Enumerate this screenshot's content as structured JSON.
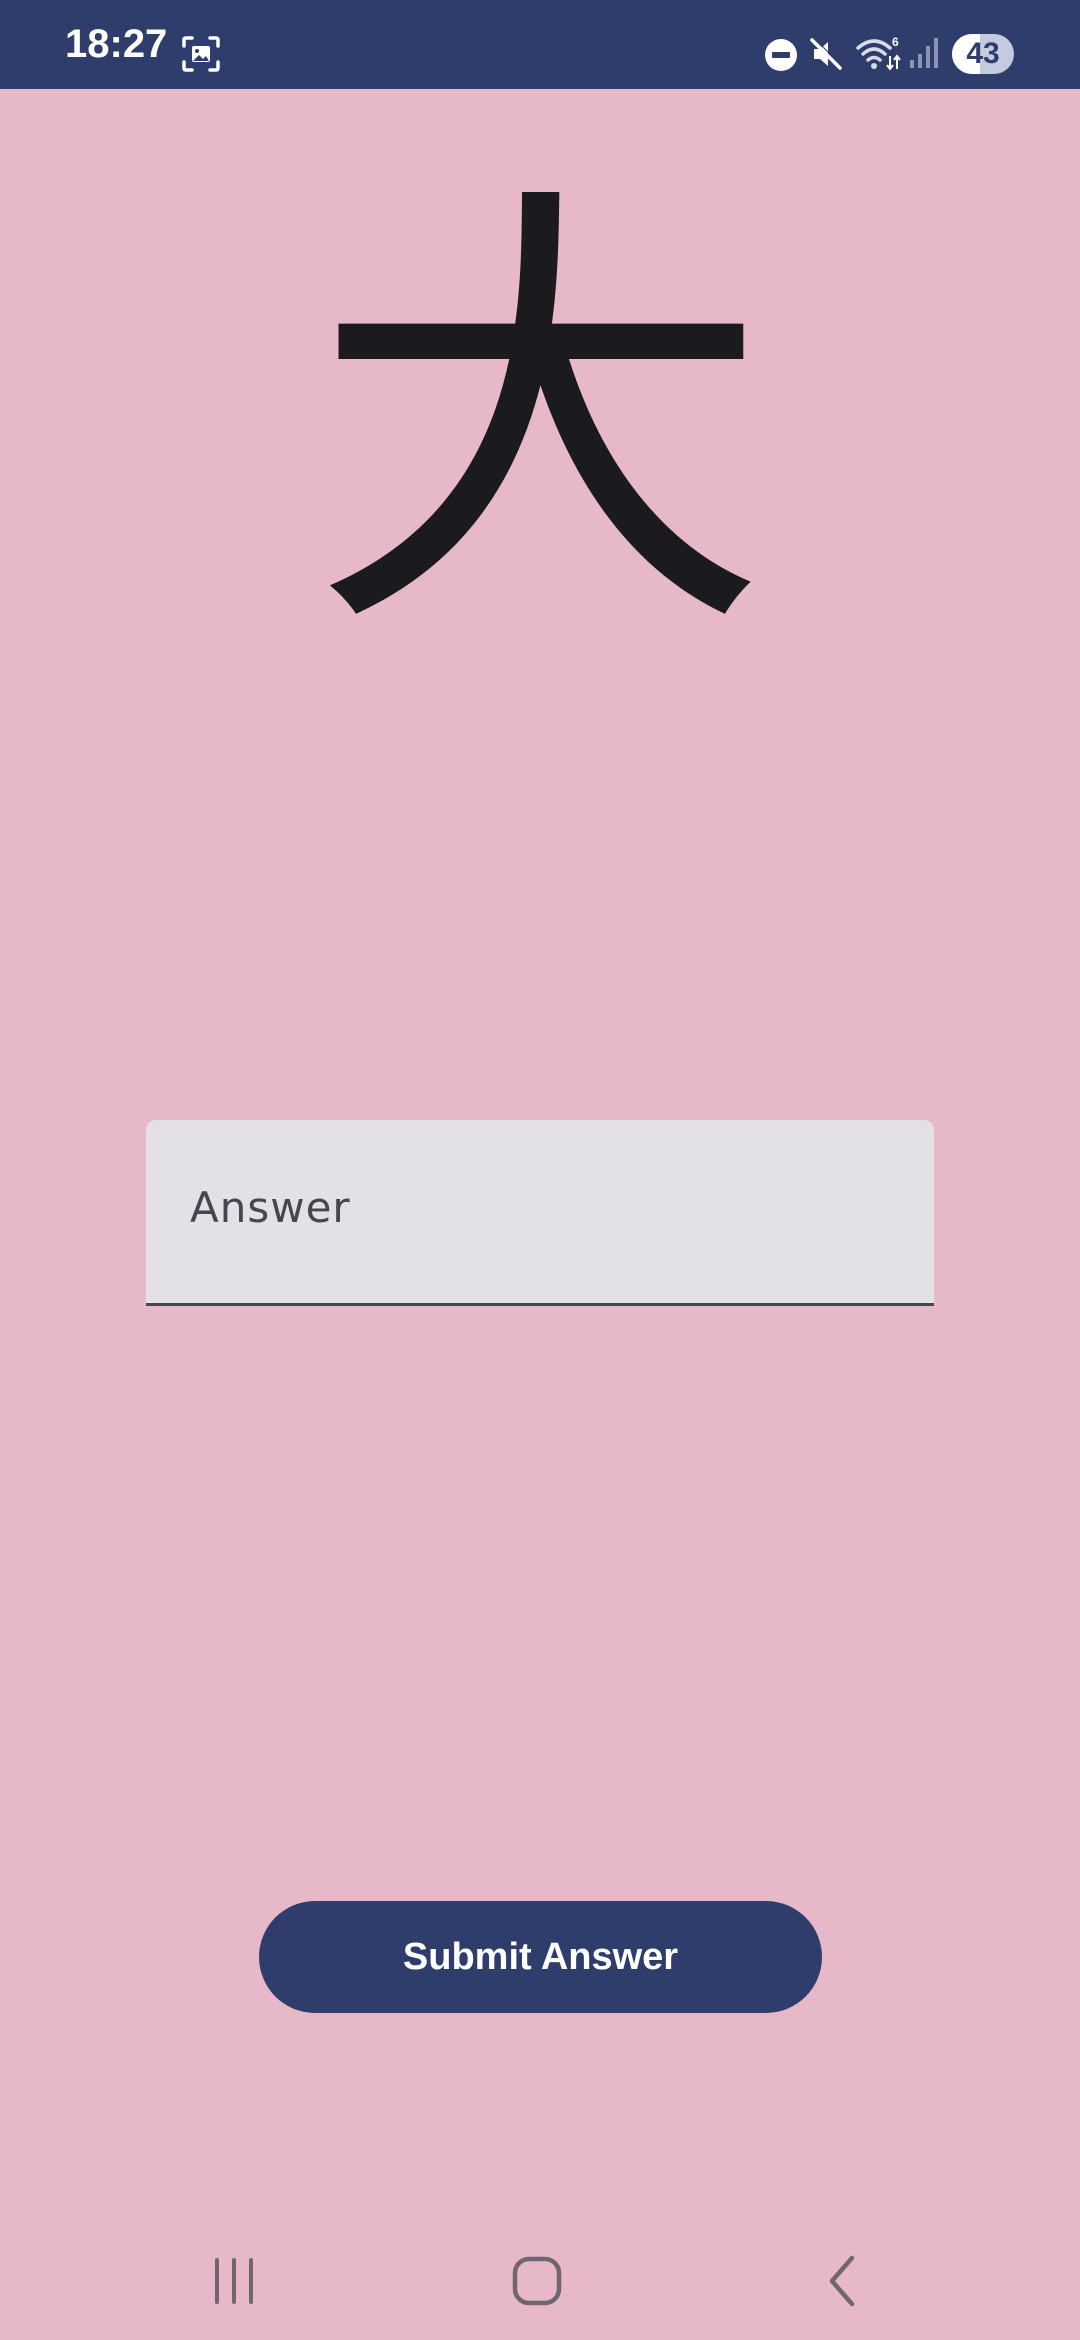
{
  "status_bar": {
    "time": "18:27",
    "battery_level": "43",
    "left_icons": [
      "screenshot-icon"
    ],
    "right_icons": [
      "do-not-disturb-icon",
      "mute-icon",
      "wifi-icon",
      "signal-icon",
      "battery-icon"
    ],
    "background_color": "#2e3d6c"
  },
  "quiz": {
    "character": "大"
  },
  "answer_field": {
    "placeholder": "Answer",
    "value": ""
  },
  "submit": {
    "label": "Submit Answer",
    "color": "#2e3d6c"
  },
  "nav_bar": {
    "items": [
      "recent-apps-icon",
      "home-icon",
      "back-icon"
    ]
  },
  "theme": {
    "background": "#e7b9c8",
    "field_background": "#e3e1e7"
  }
}
